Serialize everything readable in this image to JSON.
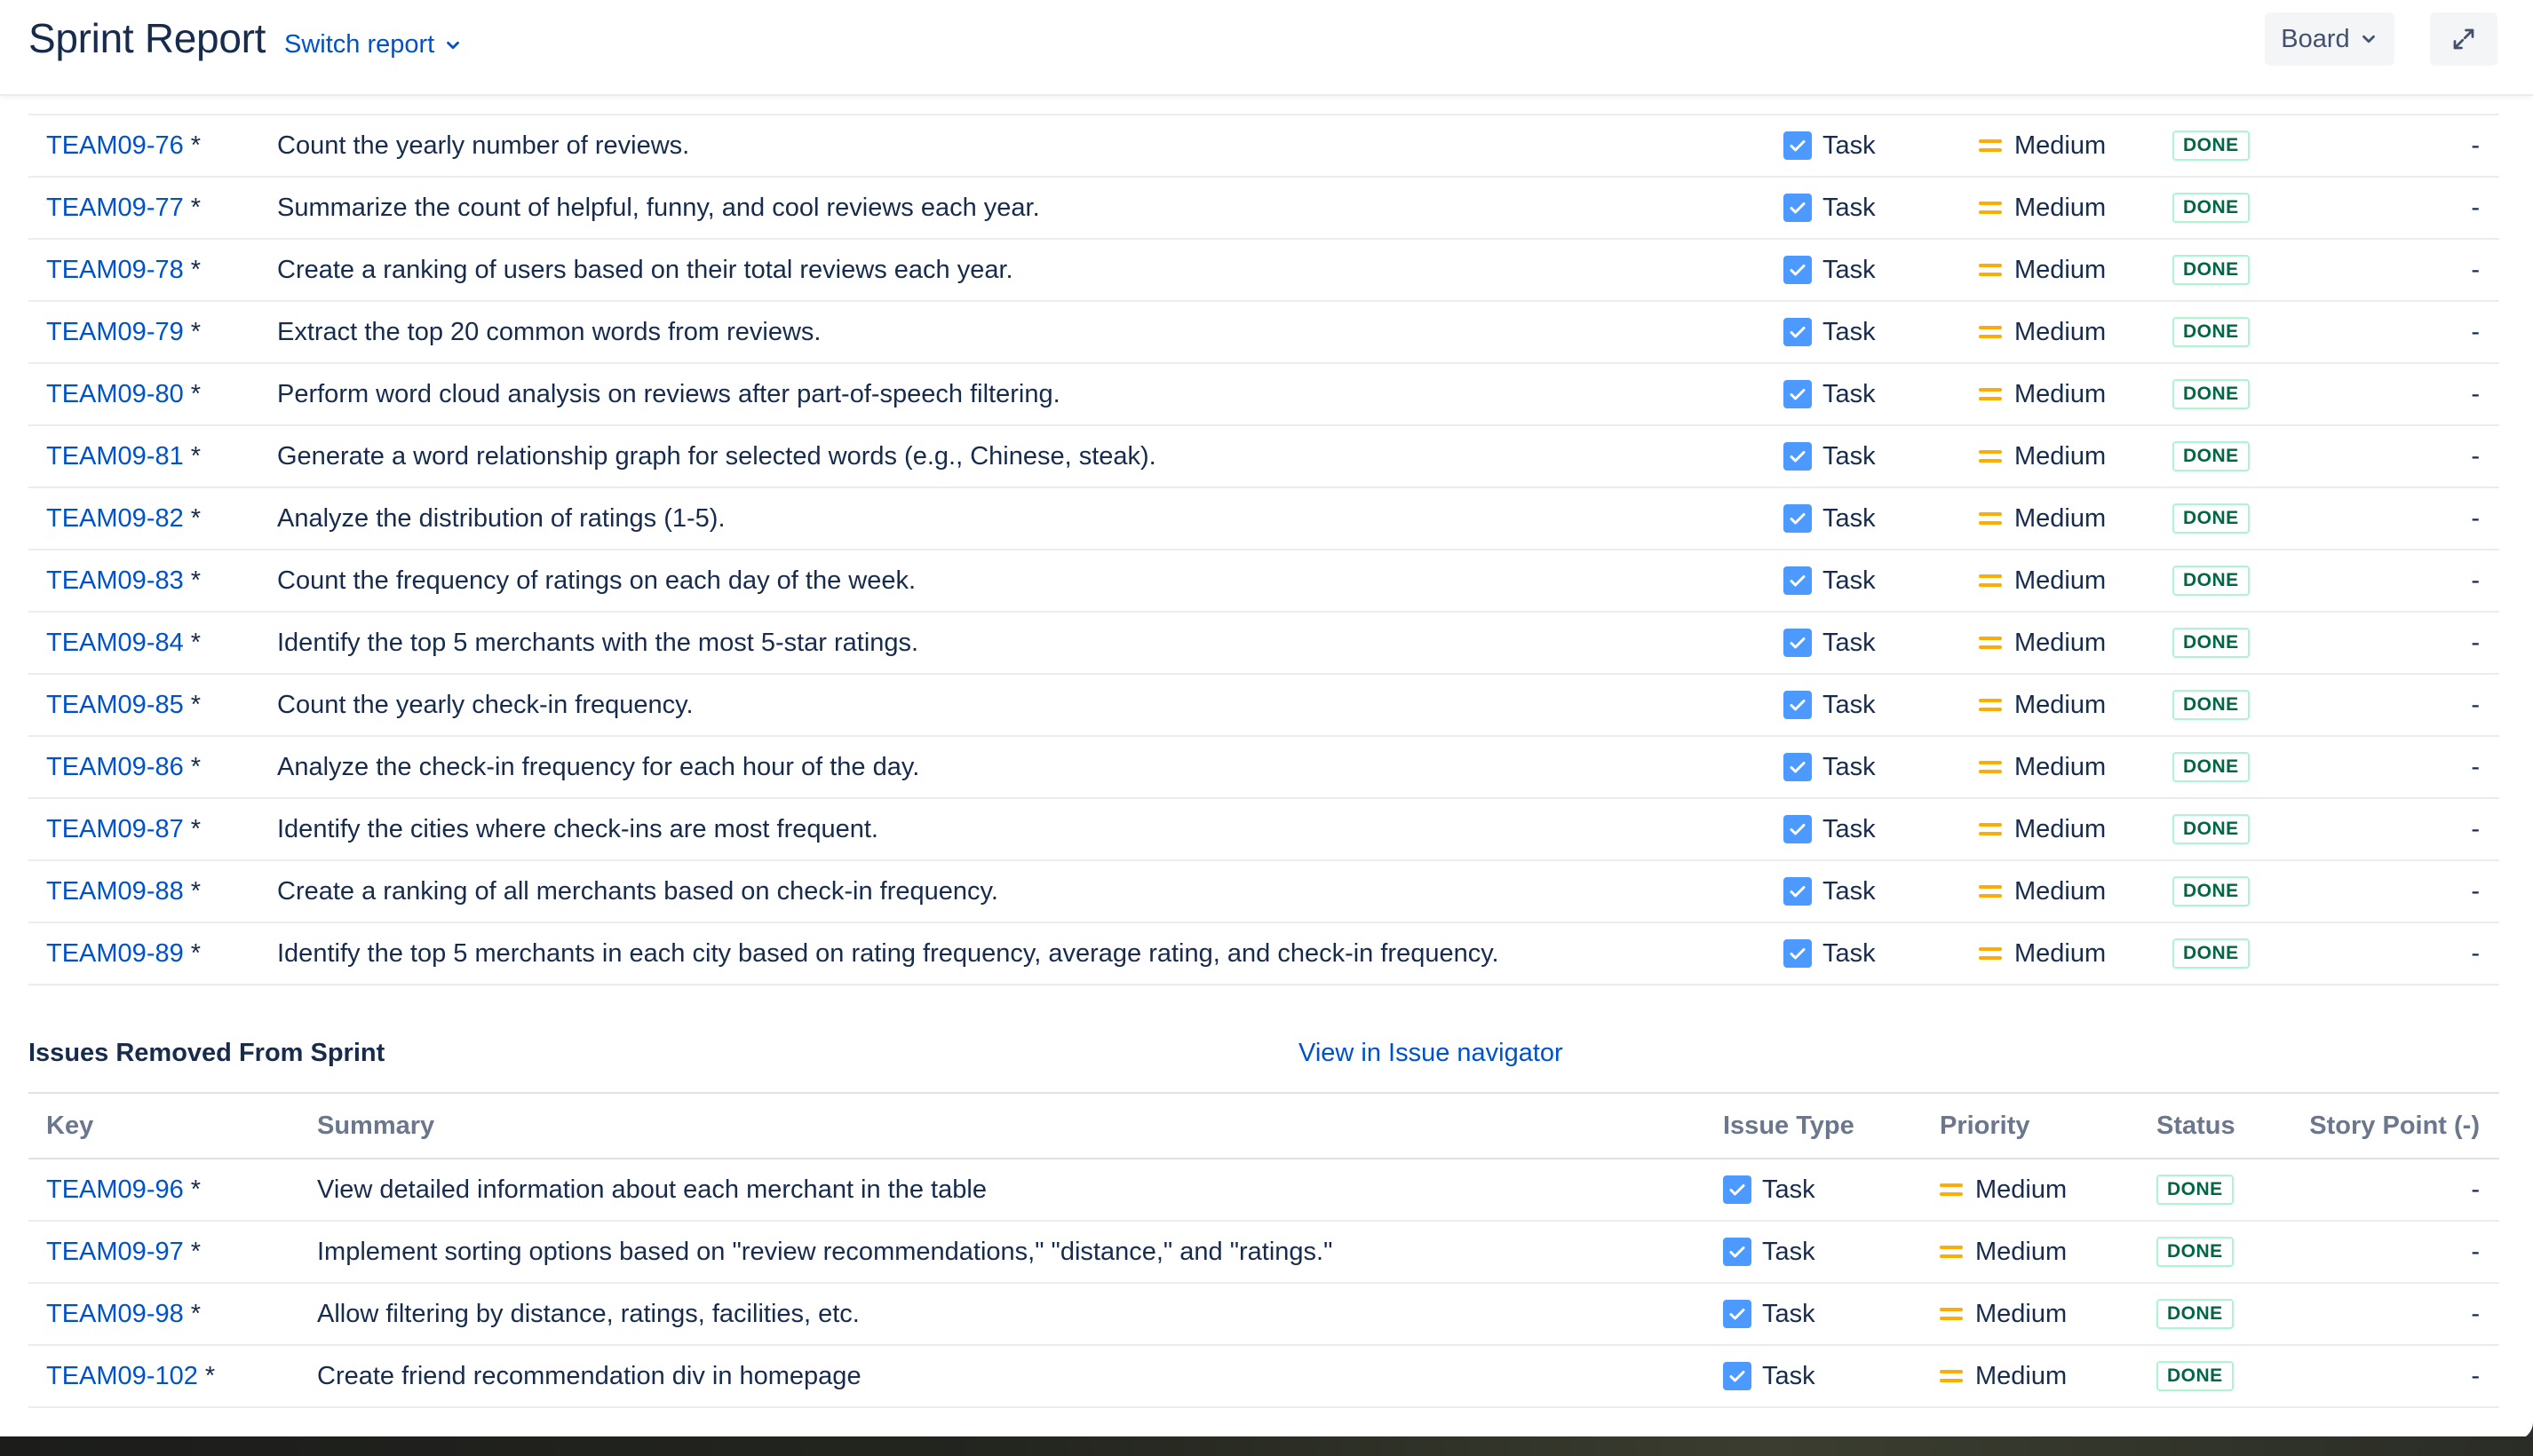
{
  "header": {
    "title": "Sprint Report",
    "switch_report": "Switch report",
    "board_label": "Board"
  },
  "completed_issues": [
    {
      "key": "TEAM09-76",
      "summary": "Count the yearly number of reviews.",
      "type": "Task",
      "priority": "Medium",
      "status": "DONE",
      "story_point": "-"
    },
    {
      "key": "TEAM09-77",
      "summary": "Summarize the count of helpful, funny, and cool reviews each year.",
      "type": "Task",
      "priority": "Medium",
      "status": "DONE",
      "story_point": "-"
    },
    {
      "key": "TEAM09-78",
      "summary": "Create a ranking of users based on their total reviews each year.",
      "type": "Task",
      "priority": "Medium",
      "status": "DONE",
      "story_point": "-"
    },
    {
      "key": "TEAM09-79",
      "summary": "Extract the top 20 common words from reviews.",
      "type": "Task",
      "priority": "Medium",
      "status": "DONE",
      "story_point": "-"
    },
    {
      "key": "TEAM09-80",
      "summary": "Perform word cloud analysis on reviews after part-of-speech filtering.",
      "type": "Task",
      "priority": "Medium",
      "status": "DONE",
      "story_point": "-"
    },
    {
      "key": "TEAM09-81",
      "summary": "Generate a word relationship graph for selected words (e.g., Chinese, steak).",
      "type": "Task",
      "priority": "Medium",
      "status": "DONE",
      "story_point": "-"
    },
    {
      "key": "TEAM09-82",
      "summary": "Analyze the distribution of ratings (1-5).",
      "type": "Task",
      "priority": "Medium",
      "status": "DONE",
      "story_point": "-"
    },
    {
      "key": "TEAM09-83",
      "summary": "Count the frequency of ratings on each day of the week.",
      "type": "Task",
      "priority": "Medium",
      "status": "DONE",
      "story_point": "-"
    },
    {
      "key": "TEAM09-84",
      "summary": "Identify the top 5 merchants with the most 5-star ratings.",
      "type": "Task",
      "priority": "Medium",
      "status": "DONE",
      "story_point": "-"
    },
    {
      "key": "TEAM09-85",
      "summary": "Count the yearly check-in frequency.",
      "type": "Task",
      "priority": "Medium",
      "status": "DONE",
      "story_point": "-"
    },
    {
      "key": "TEAM09-86",
      "summary": "Analyze the check-in frequency for each hour of the day.",
      "type": "Task",
      "priority": "Medium",
      "status": "DONE",
      "story_point": "-"
    },
    {
      "key": "TEAM09-87",
      "summary": "Identify the cities where check-ins are most frequent.",
      "type": "Task",
      "priority": "Medium",
      "status": "DONE",
      "story_point": "-"
    },
    {
      "key": "TEAM09-88",
      "summary": "Create a ranking of all merchants based on check-in frequency.",
      "type": "Task",
      "priority": "Medium",
      "status": "DONE",
      "story_point": "-"
    },
    {
      "key": "TEAM09-89",
      "summary": "Identify the top 5 merchants in each city based on rating frequency, average rating, and check-in frequency.",
      "type": "Task",
      "priority": "Medium",
      "status": "DONE",
      "story_point": "-"
    }
  ],
  "removed_section": {
    "title": "Issues Removed From Sprint",
    "navigator_link": "View in Issue navigator",
    "columns": {
      "key": "Key",
      "summary": "Summary",
      "type": "Issue Type",
      "priority": "Priority",
      "status": "Status",
      "story_point": "Story Point (-)"
    },
    "issues": [
      {
        "key": "TEAM09-96",
        "summary": "View detailed information about each merchant in the table",
        "type": "Task",
        "priority": "Medium",
        "status": "DONE",
        "story_point": "-"
      },
      {
        "key": "TEAM09-97",
        "summary": "Implement sorting options based on \"review recommendations,\" \"distance,\" and \"ratings.\"",
        "type": "Task",
        "priority": "Medium",
        "status": "DONE",
        "story_point": "-"
      },
      {
        "key": "TEAM09-98",
        "summary": "Allow filtering by distance, ratings, facilities, etc.",
        "type": "Task",
        "priority": "Medium",
        "status": "DONE",
        "story_point": "-"
      },
      {
        "key": "TEAM09-102",
        "summary": "Create friend recommendation div in homepage",
        "type": "Task",
        "priority": "Medium",
        "status": "DONE",
        "story_point": "-"
      }
    ]
  },
  "key_suffix": "*",
  "colors": {
    "link": "#0052cc",
    "text": "#172b4d",
    "priority_medium": "#ffab00",
    "task_icon": "#4c9aff",
    "done_border": "#abf5d1",
    "done_text": "#006644"
  },
  "icons": {
    "switch_report": "chevron-down-icon",
    "board": "chevron-down-icon",
    "expand": "expand-icon",
    "task": "task-checkbox-icon",
    "priority": "priority-medium-icon"
  }
}
